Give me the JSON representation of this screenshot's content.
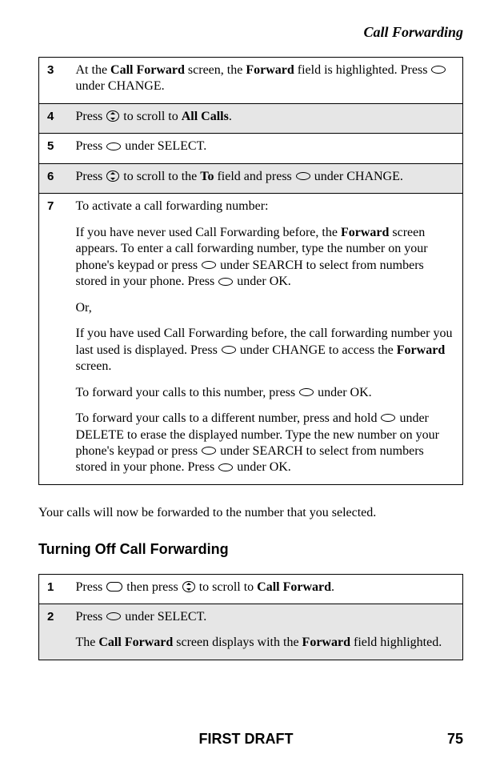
{
  "header": {
    "title": "Call Forwarding"
  },
  "table1": {
    "rows": [
      {
        "n": "3",
        "shaded": false,
        "html": "At the <b>Call Forward</b> screen, the <b>Forward</b> field is highlighted. Press <span class=\"icon-oval\" data-name=\"softkey-icon\" data-interactable=\"false\"></span> under CHANGE."
      },
      {
        "n": "4",
        "shaded": true,
        "html": "Press <span class=\"icon-scroll\" data-name=\"scroll-icon\" data-interactable=\"false\"></span> to scroll to <b>All Calls</b>."
      },
      {
        "n": "5",
        "shaded": false,
        "html": "Press <span class=\"icon-oval\" data-name=\"softkey-icon\" data-interactable=\"false\"></span> under SELECT."
      },
      {
        "n": "6",
        "shaded": true,
        "html": "Press <span class=\"icon-scroll\" data-name=\"scroll-icon\" data-interactable=\"false\"></span> to scroll to the <b>To</b> field and press <span class=\"icon-oval\" data-name=\"softkey-icon\" data-interactable=\"false\"></span> under CHANGE."
      },
      {
        "n": "7",
        "shaded": false,
        "html": "<div class=\"para\">To activate a call forwarding number:</div><div class=\"para\">If you have never used Call Forwarding before, the <b>Forward</b> screen appears. To enter a call forwarding number, type the number on your phone's keypad or press <span class=\"icon-oval\" data-name=\"softkey-icon\" data-interactable=\"false\"></span> under SEARCH to select from numbers stored in your phone. Press <span class=\"icon-oval\" data-name=\"softkey-icon\" data-interactable=\"false\"></span> under OK.</div><div class=\"para\">Or,</div><div class=\"para\">If you have used Call Forwarding before, the call forwarding number you last used is displayed. Press <span class=\"icon-oval\" data-name=\"softkey-icon\" data-interactable=\"false\"></span> under CHANGE to access the <b>Forward</b> screen.</div><div class=\"para\">To forward your calls to this number, press <span class=\"icon-oval\" data-name=\"softkey-icon\" data-interactable=\"false\"></span> under OK.</div><div>To forward your calls to a different number, press and hold <span class=\"icon-oval\" data-name=\"softkey-icon\" data-interactable=\"false\"></span> under DELETE to erase the displayed number. Type the new number on your phone's keypad or press <span class=\"icon-oval\" data-name=\"softkey-icon\" data-interactable=\"false\"></span> under SEARCH to select from numbers stored in your phone. Press <span class=\"icon-oval\" data-name=\"softkey-icon\" data-interactable=\"false\"></span> under OK.</div>"
      }
    ]
  },
  "middle_text": "Your calls will now be forwarded to the number that you selected.",
  "subheading": "Turning Off Call Forwarding",
  "table2": {
    "rows": [
      {
        "n": "1",
        "shaded": false,
        "html": "Press <span class=\"icon-menu\" data-name=\"menu-key-icon\" data-interactable=\"false\"></span> then press <span class=\"icon-scroll\" data-name=\"scroll-icon\" data-interactable=\"false\"></span> to scroll to <b>Call Forward</b>."
      },
      {
        "n": "2",
        "shaded": true,
        "html": "<div class=\"para\">Press <span class=\"icon-oval\" data-name=\"softkey-icon\" data-interactable=\"false\"></span> under SELECT.</div><div>The <b>Call Forward</b> screen displays with the <b>Forward</b> field highlighted.</div>"
      }
    ]
  },
  "footer": {
    "draft": "FIRST DRAFT",
    "page": "75"
  }
}
